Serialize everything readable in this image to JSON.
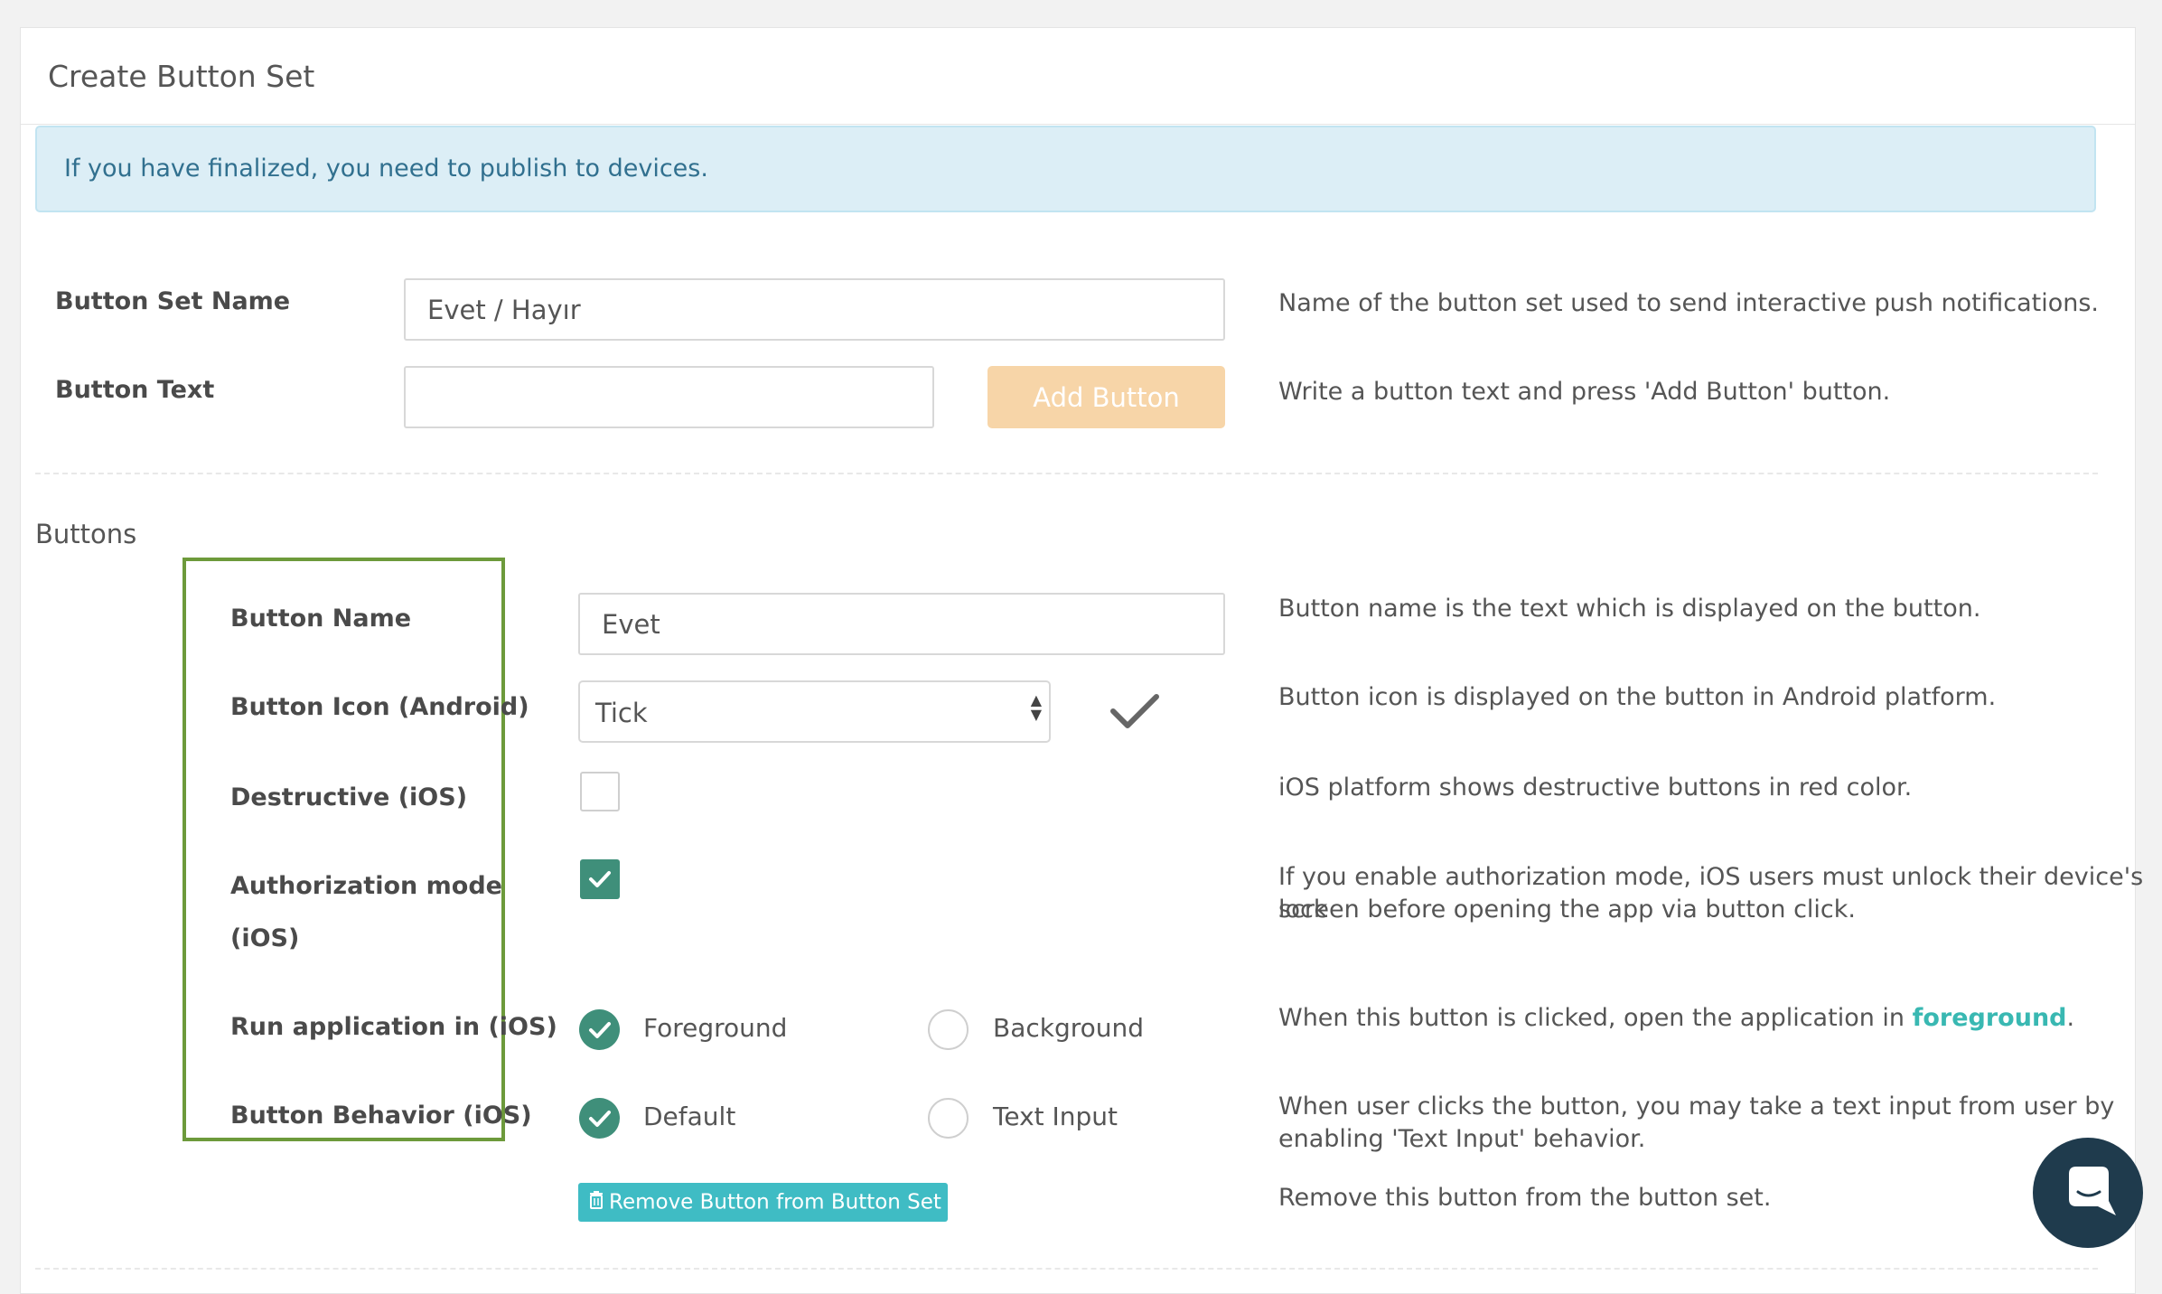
{
  "page": {
    "title": "Create Button Set"
  },
  "alert": {
    "text": "If you have finalized, you need to publish to devices."
  },
  "button_set_name": {
    "label": "Button Set Name",
    "value": "Evet / Hayır",
    "help": "Name of the button set used to send interactive push notifications."
  },
  "button_text": {
    "label": "Button Text",
    "value": "",
    "add_button_label": "Add Button",
    "help": "Write a button text and press 'Add Button' button."
  },
  "buttons_section": {
    "title": "Buttons"
  },
  "button_item": {
    "name": {
      "label": "Button Name",
      "value": "Evet",
      "help": "Button name is the text which is displayed on the button."
    },
    "icon": {
      "label": "Button Icon (Android)",
      "selected": "Tick",
      "preview_icon": "checkmark-icon",
      "help": "Button icon is displayed on the button in Android platform."
    },
    "destructive": {
      "label": "Destructive (iOS)",
      "checked": false,
      "help": "iOS platform shows destructive buttons in red color."
    },
    "authorization": {
      "label_line1": "Authorization mode",
      "label_line2": "(iOS)",
      "checked": true,
      "help_line1": "If you enable authorization mode, iOS users must unlock their device's lock",
      "help_line2": "screen before opening the app via button click."
    },
    "run_application": {
      "label": "Run application in (iOS)",
      "options": [
        "Foreground",
        "Background"
      ],
      "selected": "Foreground",
      "help_prefix": "When this button is clicked, open the application in ",
      "help_link": "foreground",
      "help_suffix": "."
    },
    "behavior": {
      "label": "Button Behavior (iOS)",
      "options": [
        "Default",
        "Text Input"
      ],
      "selected": "Default",
      "help_line1": "When user clicks the button, you may take a text input from user by",
      "help_line2": "enabling 'Text Input' behavior."
    },
    "remove": {
      "label": "Remove Button from Button Set",
      "icon": "trash-icon",
      "help": "Remove this button from the button set."
    }
  },
  "chat_widget": {
    "icon": "chat-bubble-icon"
  },
  "colors": {
    "accent_green": "#3f8f7a",
    "highlight_border": "#6d9a3b",
    "add_button": "#f7d5a8",
    "remove_button": "#3fbcc4",
    "link": "#39b8b2",
    "alert_bg": "#dceef6"
  }
}
